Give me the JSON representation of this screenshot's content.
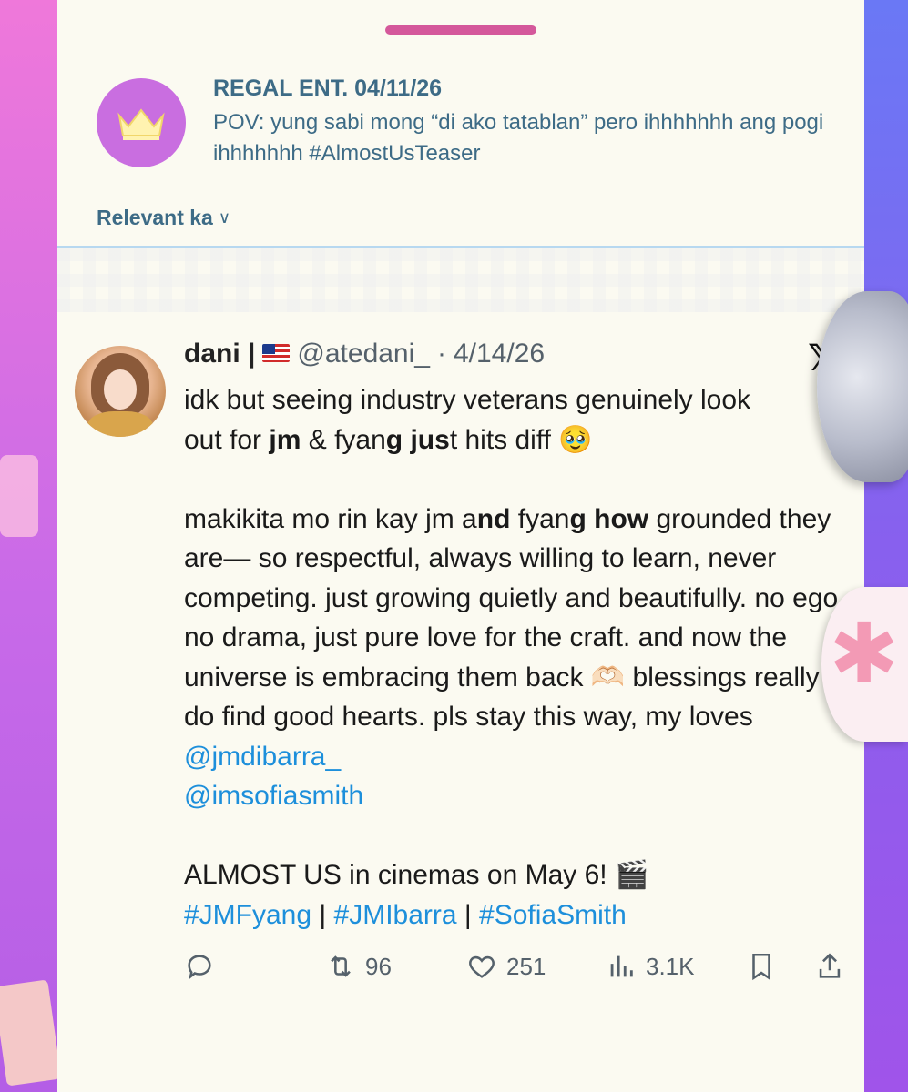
{
  "quoted": {
    "title": "REGAL ENT. 04/11/26",
    "text": "POV: yung sabi mong “di ako tatablan” pero ihhhhhhh ang pogi ihhhhhhh  #AlmostUsTeaser",
    "avatar_icon": "crown-icon",
    "avatar_color": "#c96ee0"
  },
  "sort": {
    "label": "Relevant ka",
    "chevron": "∨"
  },
  "tweet": {
    "name": "dani |",
    "handle": "@atedani_",
    "dot": "·",
    "date": "4/14/26",
    "platform_icon": "x-logo-icon",
    "line1_a": "idk but seeing industry veterans genuinely look",
    "line1_b_pre": "out for ",
    "line1_b_bold1": "jm",
    "line1_b_mid": " & fyan",
    "line1_b_bold2": "g jus",
    "line1_b_post": "t hits diff 🥹",
    "p2_pre": "makikita mo rin kay jm a",
    "p2_bold1": "nd",
    "p2_mid": " fyan",
    "p2_bold2": "g how",
    "p2_post": " grounded they are— so respectful, always willing to learn, never competing. just growing quietly and beautifully. no ego, no drama, just pure love for the craft. and now the universe is embracing them back 🫶🏻 blessings really do find good hearts. pls stay this way, my loves ",
    "mention1": "@jmdibarra_",
    "mention2": "@imsofiasmith",
    "p3": "ALMOST US in cinemas on May 6! 🎬",
    "tag1": "#JMFyang",
    "sep": " | ",
    "tag2": "#JMIbarra",
    "tag3": "#SofiaSmith",
    "link_color": "#1d8fdb"
  },
  "actions": {
    "reply_icon": "reply-icon",
    "retweet_icon": "retweet-icon",
    "retweet_count": "96",
    "like_icon": "heart-icon",
    "like_count": "251",
    "views_icon": "views-icon",
    "views_count": "3.1K",
    "bookmark_icon": "bookmark-icon",
    "share_icon": "share-icon"
  }
}
